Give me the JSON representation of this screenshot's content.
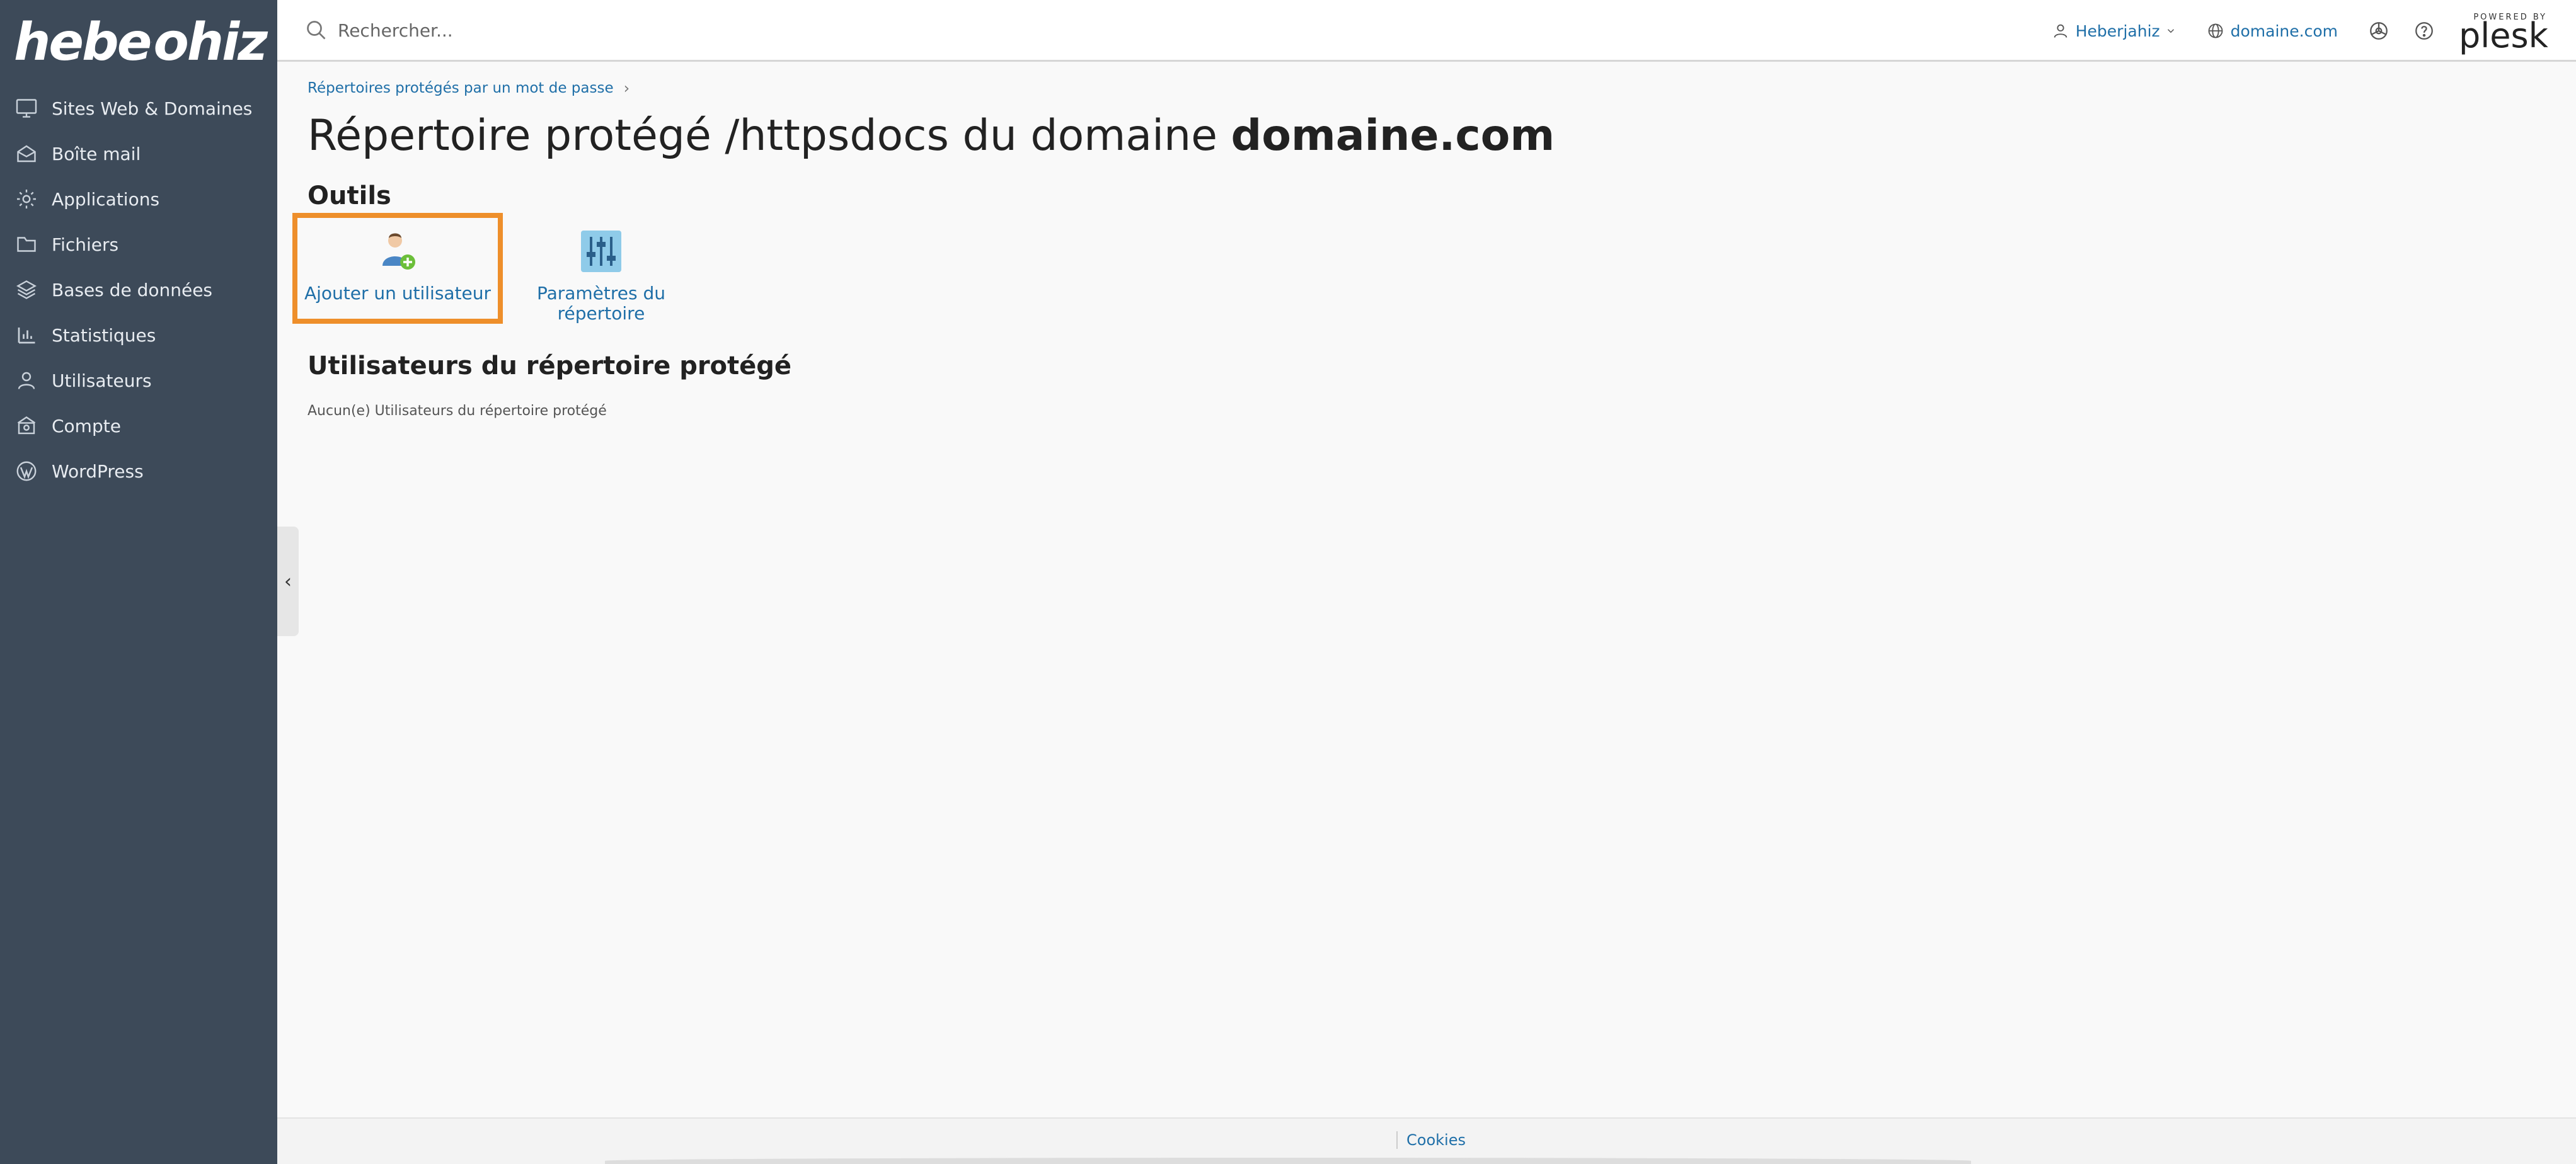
{
  "brand": {
    "logo_prefix": "hebe",
    "logo_suffix": "ohiz"
  },
  "sidebar": {
    "items": [
      {
        "label": "Sites Web & Domaines",
        "icon": "monitor-icon"
      },
      {
        "label": "Boîte mail",
        "icon": "mail-icon"
      },
      {
        "label": "Applications",
        "icon": "gear-icon"
      },
      {
        "label": "Fichiers",
        "icon": "folder-icon"
      },
      {
        "label": "Bases de données",
        "icon": "database-icon"
      },
      {
        "label": "Statistiques",
        "icon": "bar-chart-icon"
      },
      {
        "label": "Utilisateurs",
        "icon": "user-icon"
      },
      {
        "label": "Compte",
        "icon": "account-icon"
      },
      {
        "label": "WordPress",
        "icon": "wordpress-icon"
      }
    ],
    "collapse_glyph": "‹"
  },
  "topbar": {
    "search_placeholder": "Rechercher...",
    "user_label": "Heberjahiz",
    "domain_label": "domaine.com",
    "powered_by": "POWERED BY",
    "plesk": "plesk"
  },
  "main": {
    "breadcrumb": "Répertoires protégés par un mot de passe",
    "breadcrumb_sep": "›",
    "title_prefix": "Répertoire protégé /httpsdocs du domaine ",
    "title_domain": "domaine.com",
    "tools_title": "Outils",
    "tools": [
      {
        "label": "Ajouter un utilisateur",
        "icon": "add-user-icon"
      },
      {
        "label_line1": "Paramètres du",
        "label_line2": "répertoire",
        "icon": "settings-sliders-icon"
      }
    ],
    "users_title": "Utilisateurs du répertoire protégé",
    "empty_message": "Aucun(e) Utilisateurs du répertoire protégé"
  },
  "footer": {
    "cookies": "Cookies"
  },
  "colors": {
    "sidebar_bg": "#3d4a59",
    "link": "#1f6fa8",
    "highlight": "#ee8f2b",
    "page_bg": "#f9f9f9"
  }
}
